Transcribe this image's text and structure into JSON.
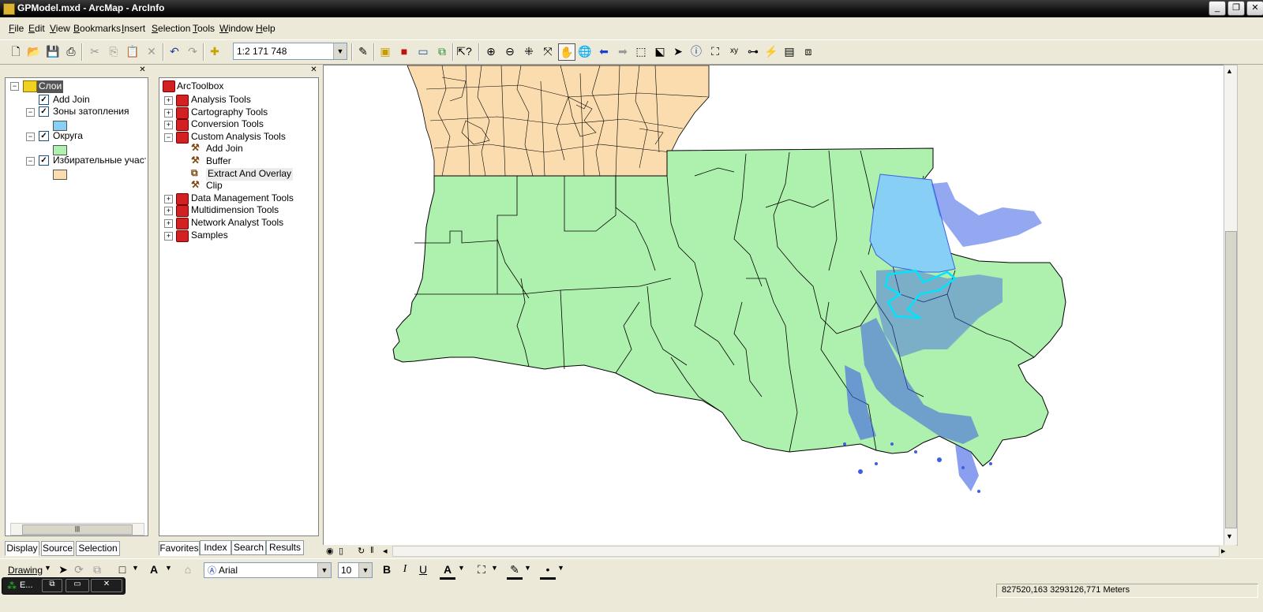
{
  "window": {
    "title": "GPModel.mxd - ArcMap - ArcInfo"
  },
  "menu": [
    {
      "label": "File",
      "hotkey": "F",
      "rest": "ile"
    },
    {
      "label": "Edit",
      "hotkey": "E",
      "rest": "dit"
    },
    {
      "label": "View",
      "hotkey": "V",
      "rest": "iew"
    },
    {
      "label": "Bookmarks",
      "hotkey": "B",
      "rest": "ookmarks"
    },
    {
      "label": "Insert",
      "hotkey": "I",
      "rest": "nsert"
    },
    {
      "label": "Selection",
      "hotkey": "S",
      "rest": "election"
    },
    {
      "label": "Tools",
      "hotkey": "T",
      "rest": "ools"
    },
    {
      "label": "Window",
      "hotkey": "W",
      "rest": "indow"
    },
    {
      "label": "Help",
      "hotkey": "H",
      "rest": "elp"
    }
  ],
  "toolbar": {
    "scale": "1:2 171 748"
  },
  "toc": {
    "root": "Слои",
    "layers": [
      {
        "name": "Add Join",
        "checked": true
      },
      {
        "name": "Зоны затопления",
        "checked": true,
        "color": "#87cff5"
      },
      {
        "name": "Округа",
        "checked": true,
        "color": "#aef0ae"
      },
      {
        "name": "Избирательные участк",
        "checked": true,
        "color": "#fbdcae"
      }
    ],
    "tabs": [
      "Display",
      "Source",
      "Selection"
    ]
  },
  "toolbox": {
    "root": "ArcToolbox",
    "items": [
      "Analysis Tools",
      "Cartography Tools",
      "Conversion Tools",
      "Custom Analysis Tools",
      "Data Management Tools",
      "Multidimension Tools",
      "Network Analyst Tools",
      "Samples"
    ],
    "custom_tools": [
      "Add Join",
      "Buffer",
      "Extract And Overlay",
      "Clip"
    ],
    "tabs": [
      "Favorites",
      "Index",
      "Search",
      "Results"
    ]
  },
  "drawing": {
    "label": "Drawing",
    "font": "Arial",
    "size": "10"
  },
  "status": {
    "coords": "827520,163  3293126,771 Meters",
    "task": "E..."
  },
  "colors": {
    "parishes": "#aef0ae",
    "precincts": "#fbdcae",
    "flood": "#87cff5",
    "water": "#3c5fe6",
    "outline": "#00e5ff"
  }
}
